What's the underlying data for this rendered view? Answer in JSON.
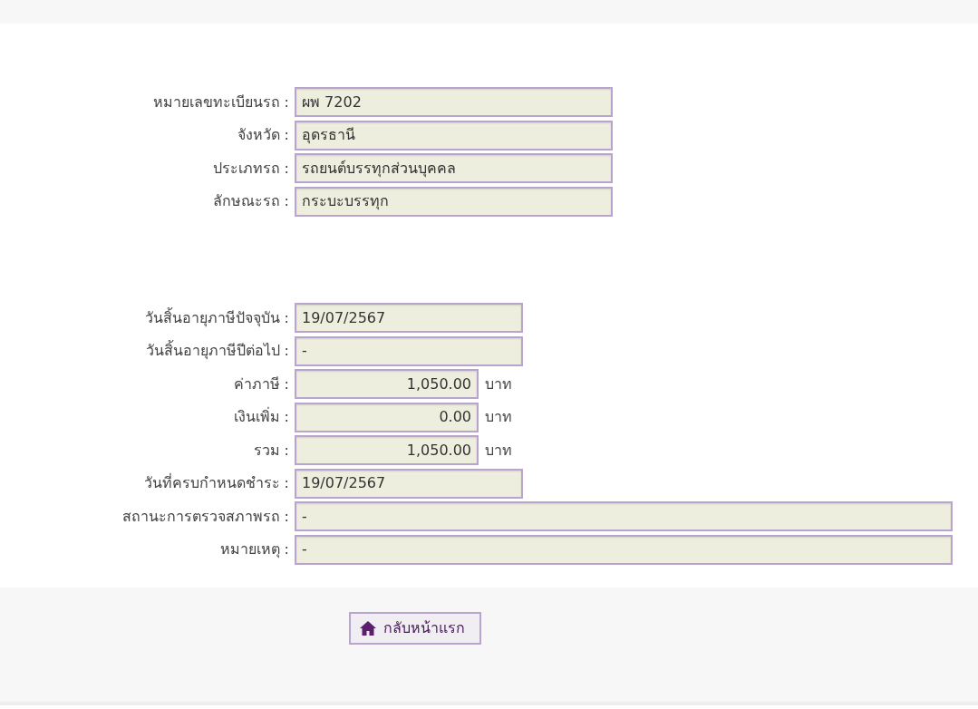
{
  "sections": [
    {
      "fields": [
        {
          "label": "หมายเลขทะเบียนรถ :",
          "value": "ผพ 7202",
          "kind": "text"
        },
        {
          "label": "จังหวัด :",
          "value": "อุดรธานี",
          "kind": "text"
        },
        {
          "label": "ประเภทรถ :",
          "value": "รถยนต์บรรทุกส่วนบุคคล",
          "kind": "text"
        },
        {
          "label": "ลักษณะรถ :",
          "value": "กระบะบรรทุก",
          "kind": "text"
        }
      ]
    },
    {
      "fields": [
        {
          "label": "วันสิ้นอายุภาษีปัจจุบัน :",
          "value": "19/07/2567",
          "kind": "date"
        },
        {
          "label": "วันสิ้นอายุภาษีปีต่อไป :",
          "value": "-",
          "kind": "date"
        },
        {
          "label": "ค่าภาษี :",
          "value": "1,050.00",
          "kind": "amount",
          "unit": "บาท"
        },
        {
          "label": "เงินเพิ่ม :",
          "value": "0.00",
          "kind": "amount",
          "unit": "บาท"
        },
        {
          "label": "รวม :",
          "value": "1,050.00",
          "kind": "amount",
          "unit": "บาท"
        },
        {
          "label": "วันที่ครบกำหนดชำระ :",
          "value": "19/07/2567",
          "kind": "date"
        },
        {
          "label": "สถานะการตรวจสภาพรถ :",
          "value": "-",
          "kind": "long"
        },
        {
          "label": "หมายเหตุ :",
          "value": "-",
          "kind": "long"
        }
      ]
    }
  ],
  "home_button": {
    "label": "กลับหน้าแรก"
  }
}
